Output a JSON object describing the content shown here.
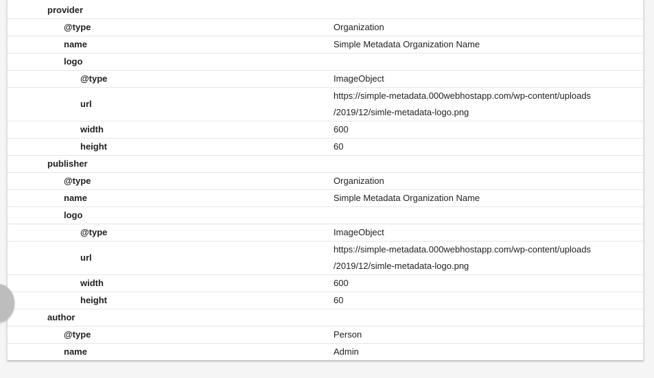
{
  "rows": [
    {
      "key": "provider",
      "value": ""
    },
    {
      "key": "@type",
      "value": "Organization"
    },
    {
      "key": "name",
      "value": "Simple Metadata Organization Name"
    },
    {
      "key": "logo",
      "value": ""
    },
    {
      "key": "@type",
      "value": "ImageObject"
    },
    {
      "key": "url",
      "value_line1": "https://simple-metadata.000webhostapp.com/wp-content/uploads",
      "value_line2": "/2019/12/simle-metadata-logo.png"
    },
    {
      "key": "width",
      "value": "600"
    },
    {
      "key": "height",
      "value": "60"
    },
    {
      "key": "publisher",
      "value": ""
    },
    {
      "key": "@type",
      "value": "Organization"
    },
    {
      "key": "name",
      "value": "Simple Metadata Organization Name"
    },
    {
      "key": "logo",
      "value": ""
    },
    {
      "key": "@type",
      "value": "ImageObject"
    },
    {
      "key": "url",
      "value_line1": "https://simple-metadata.000webhostapp.com/wp-content/uploads",
      "value_line2": "/2019/12/simle-metadata-logo.png"
    },
    {
      "key": "width",
      "value": "600"
    },
    {
      "key": "height",
      "value": "60"
    },
    {
      "key": "author",
      "value": ""
    },
    {
      "key": "@type",
      "value": "Person"
    },
    {
      "key": "name",
      "value": "Admin"
    }
  ]
}
